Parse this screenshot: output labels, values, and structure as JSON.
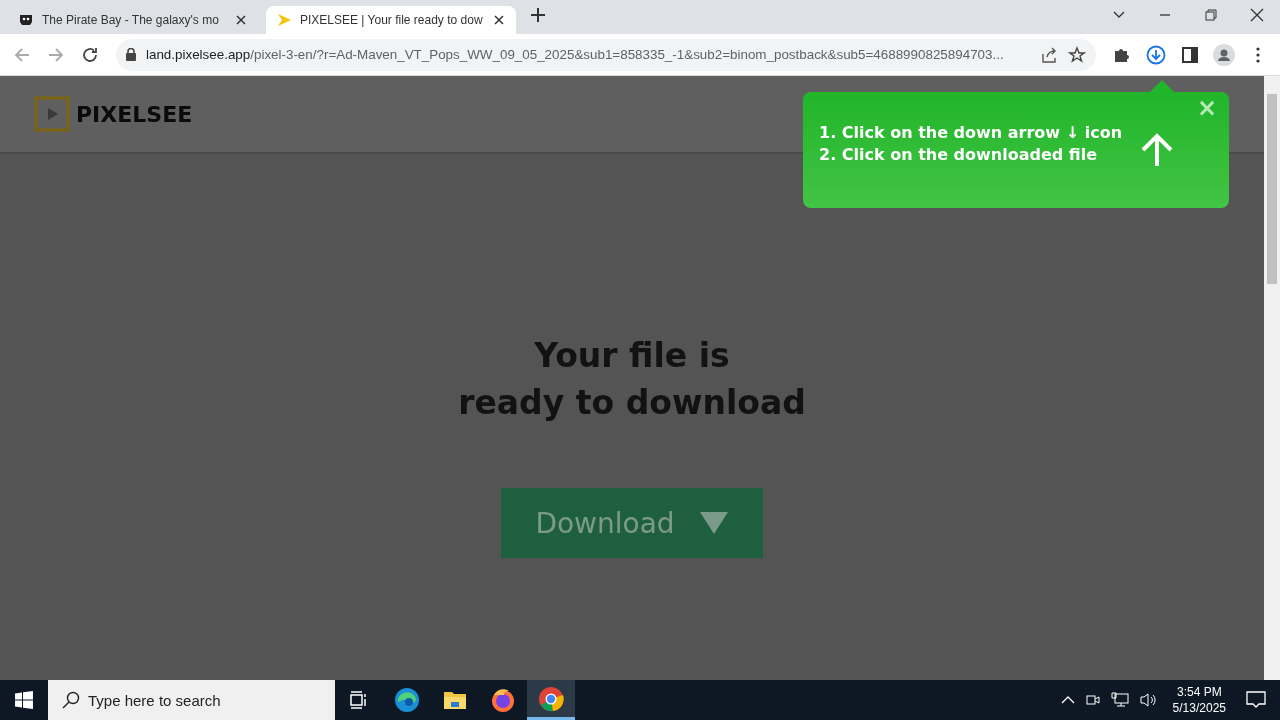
{
  "browser": {
    "tabs": [
      {
        "title": "The Pirate Bay - The galaxy's mo",
        "kind": "ship",
        "selected": false
      },
      {
        "title": "PIXELSEE | Your file ready to dow",
        "kind": "play",
        "selected": true
      }
    ],
    "address": {
      "host": "land.pixelsee.app",
      "path": "/pixel-3-en/?r=Ad-Maven_VT_Pops_WW_09_05_2025&sub1=858335_-1&sub2=binom_postback&sub5=4688990825894703..."
    }
  },
  "page": {
    "logo": "PIXELSEE",
    "heading": [
      "Your file is",
      "ready to download"
    ],
    "download_button": "Download"
  },
  "popup": {
    "steps": [
      "1. Click on the down arrow ↓ icon",
      "2. Click on the downloaded file"
    ],
    "close": "×"
  },
  "taskbar": {
    "search_placeholder": "Type here to search",
    "apps": [
      {
        "kind": "taskview",
        "selected": false
      },
      {
        "kind": "edge",
        "selected": false
      },
      {
        "kind": "explorer",
        "selected": false
      },
      {
        "kind": "firefox",
        "selected": false
      },
      {
        "kind": "chrome",
        "selected": true
      }
    ],
    "time": "3:54 PM",
    "date": "5/13/2025"
  }
}
